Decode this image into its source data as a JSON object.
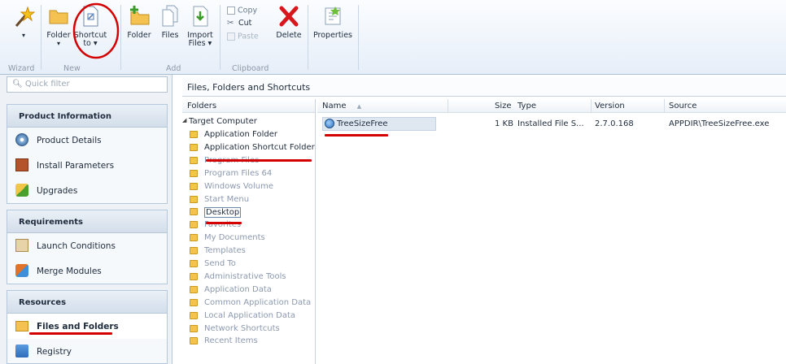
{
  "ribbon": {
    "buttons": {
      "wizard": "Wizard",
      "folder": "Folder",
      "shortcut": "Shortcut",
      "shortcut_sub": "to ▾",
      "add_folder": "Folder",
      "files": "Files",
      "import_files": "Import",
      "import_files_sub": "Files ▾",
      "copy": "Copy",
      "cut": "Cut",
      "paste": "Paste",
      "delete": "Delete",
      "properties": "Properties"
    },
    "groups": {
      "wizard": "Wizard",
      "new": "New",
      "add": "Add",
      "clipboard": "Clipboard"
    }
  },
  "quick_filter": {
    "placeholder": "Quick filter"
  },
  "sidebar": {
    "sections": [
      {
        "title": "Product Information",
        "items": [
          "Product Details",
          "Install Parameters",
          "Upgrades"
        ]
      },
      {
        "title": "Requirements",
        "items": [
          "Launch Conditions",
          "Merge Modules"
        ]
      },
      {
        "title": "Resources",
        "items": [
          "Files and Folders",
          "Registry"
        ]
      }
    ]
  },
  "main": {
    "title": "Files, Folders and Shortcuts"
  },
  "folders": {
    "header": "Folders",
    "root": "Target Computer",
    "items": [
      {
        "label": "Application Folder",
        "enabled": true
      },
      {
        "label": "Application Shortcut Folder",
        "enabled": true
      },
      {
        "label": "Program Files",
        "enabled": false
      },
      {
        "label": "Program Files 64",
        "enabled": false
      },
      {
        "label": "Windows Volume",
        "enabled": false
      },
      {
        "label": "Start Menu",
        "enabled": false
      },
      {
        "label": "Desktop",
        "enabled": true
      },
      {
        "label": "Favorites",
        "enabled": false
      },
      {
        "label": "My Documents",
        "enabled": false
      },
      {
        "label": "Templates",
        "enabled": false
      },
      {
        "label": "Send To",
        "enabled": false
      },
      {
        "label": "Administrative Tools",
        "enabled": false
      },
      {
        "label": "Application Data",
        "enabled": false
      },
      {
        "label": "Common Application Data",
        "enabled": false
      },
      {
        "label": "Local Application Data",
        "enabled": false
      },
      {
        "label": "Network Shortcuts",
        "enabled": false
      },
      {
        "label": "Recent Items",
        "enabled": false
      }
    ]
  },
  "file_list": {
    "columns": {
      "name": "Name",
      "size": "Size",
      "type": "Type",
      "version": "Version",
      "source": "Source"
    },
    "sort_indicator": "▲",
    "rows": [
      {
        "name": "TreeSizeFree",
        "size": "1 KB",
        "type": "Installed File S...",
        "version": "2.7.0.168",
        "source": "APPDIR\\TreeSizeFree.exe"
      }
    ]
  },
  "icons": {
    "wizard": "magic-wand-icon",
    "shortcut": "shortcut-document-icon",
    "folder": "folder-icon",
    "delete": "red-x-icon",
    "properties": "properties-icon"
  },
  "colors": {
    "annotation": "#d40000",
    "selection": "#cde4f8"
  }
}
